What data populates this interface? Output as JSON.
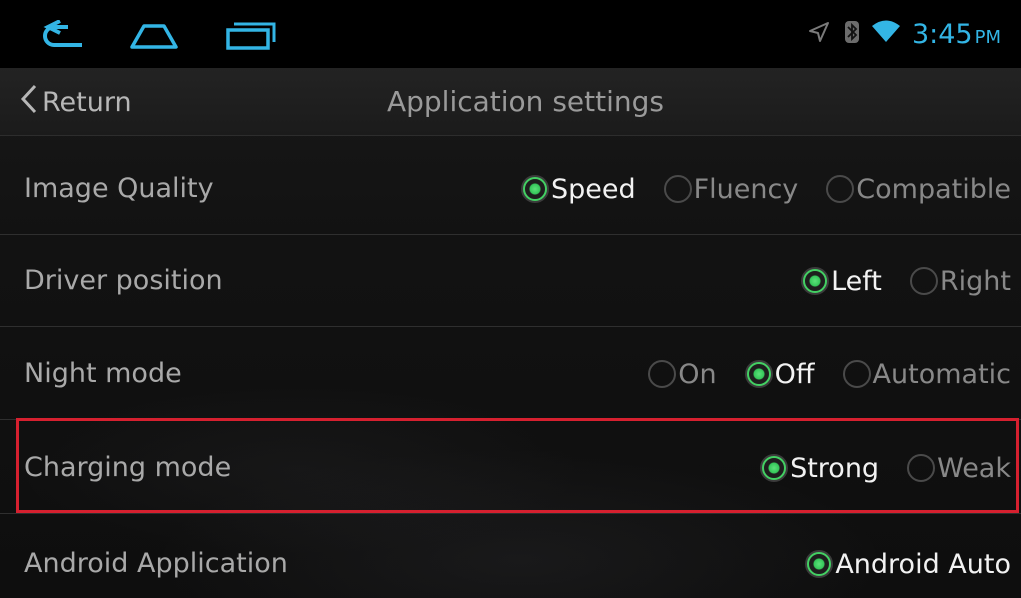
{
  "status_bar": {
    "time": "3:45",
    "ampm": "PM",
    "icons": [
      "location-arrow-icon",
      "bluetooth-icon",
      "wifi-icon"
    ],
    "clock_color": "#33b5e5"
  },
  "nav": {
    "icons": [
      "back-arrow-icon",
      "home-icon",
      "recent-apps-icon"
    ]
  },
  "title_bar": {
    "return_label": "Return",
    "title": "Application settings"
  },
  "settings": {
    "image_quality": {
      "label": "Image Quality",
      "options": [
        "Speed",
        "Fluency",
        "Compatible"
      ],
      "selected": "Speed"
    },
    "driver_position": {
      "label": "Driver position",
      "options": [
        "Left",
        "Right"
      ],
      "selected": "Left"
    },
    "night_mode": {
      "label": "Night mode",
      "options": [
        "On",
        "Off",
        "Automatic"
      ],
      "selected": "Off"
    },
    "charging_mode": {
      "label": "Charging mode",
      "options": [
        "Strong",
        "Weak"
      ],
      "selected": "Strong"
    },
    "android_application": {
      "label": "Android Application",
      "options": [
        "Android Auto"
      ],
      "selected": "Android Auto"
    }
  },
  "colors": {
    "accent_green": "#35c75a",
    "highlight_red": "#d6202f"
  }
}
